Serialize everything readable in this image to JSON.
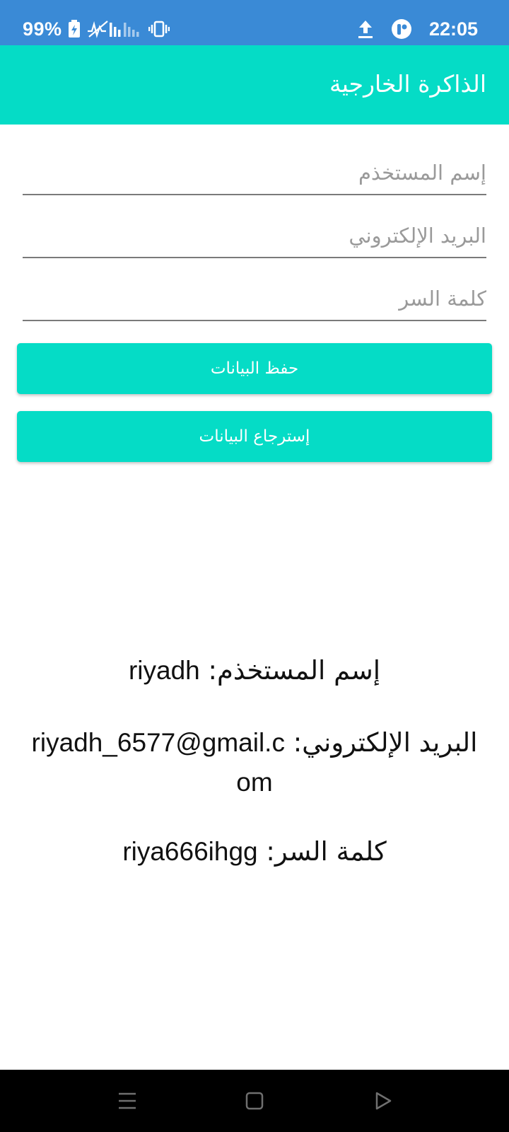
{
  "status_bar": {
    "battery_percent": "99%",
    "time": "22:05",
    "icons": [
      "battery-charging-icon",
      "signal-icon",
      "vibrate-icon",
      "upload-icon",
      "app-notification-icon"
    ]
  },
  "app_bar": {
    "title": "الذاكرة الخارجية"
  },
  "form": {
    "username_placeholder": "إسم المستخذم",
    "email_placeholder": "البريد الإلكتروني",
    "password_placeholder": "كلمة السر",
    "save_label": "حفظ البيانات",
    "load_label": "إسترجاع البيانات"
  },
  "results": {
    "username_label": "إسم المستخذم: ",
    "username_value": "riyadh",
    "email_label": "البريد الإلكتروني: ",
    "email_value": "riyadh_6577@gmail.com",
    "password_label": "كلمة السر: ",
    "password_value": "riya666ihgg"
  },
  "nav_bar": {
    "icons": [
      "menu-icon",
      "home-icon",
      "back-icon"
    ]
  },
  "colors": {
    "status_bar": "#3a8ad6",
    "accent": "#05dcc6",
    "nav_bar": "#000000"
  }
}
